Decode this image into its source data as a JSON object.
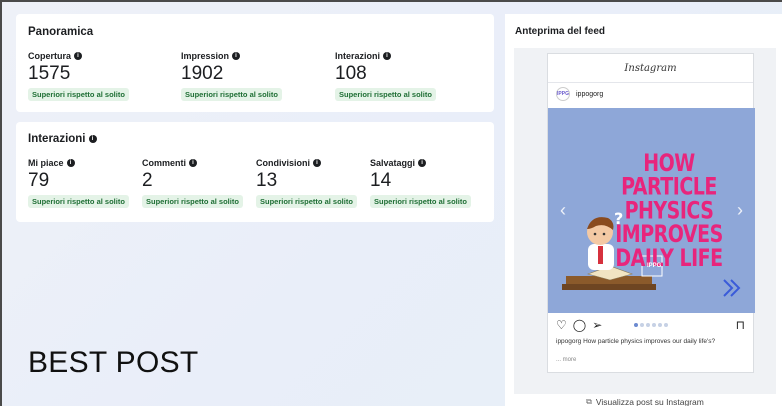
{
  "overview": {
    "title": "Panoramica",
    "metrics": [
      {
        "label": "Copertura",
        "value": "1575",
        "badge": "Superiori rispetto al solito"
      },
      {
        "label": "Impression",
        "value": "1902",
        "badge": "Superiori rispetto al solito"
      },
      {
        "label": "Interazioni",
        "value": "108",
        "badge": "Superiori rispetto al solito"
      }
    ]
  },
  "interactions": {
    "title": "Interazioni",
    "metrics": [
      {
        "label": "Mi piace",
        "value": "79",
        "badge": "Superiori rispetto al solito"
      },
      {
        "label": "Commenti",
        "value": "2",
        "badge": "Superiori rispetto al solito"
      },
      {
        "label": "Condivisioni",
        "value": "13",
        "badge": "Superiori rispetto al solito"
      },
      {
        "label": "Salvataggi",
        "value": "14",
        "badge": "Superiori rispetto al solito"
      }
    ]
  },
  "overlay_text": "BEST POST",
  "feed": {
    "title": "Anteprima del feed",
    "platform": "Instagram",
    "avatar_text": "IPPG",
    "username": "ippogorg",
    "post_headline": "HOW PARTICLE PHYSICS IMPROVES DAILY LIFE",
    "logo_text": "IPPG",
    "caption": "ippogorg How particle physics improves our daily life's?",
    "more": "... more",
    "carousel_dots": 6,
    "carousel_active": 0,
    "footer_link": "Visualizza post su Instagram",
    "headline_color": "#e8257c",
    "image_bg": "#8ea7d8"
  },
  "colors": {
    "badge_text": "#1f6f35",
    "badge_bg": "#e4f3e7"
  }
}
